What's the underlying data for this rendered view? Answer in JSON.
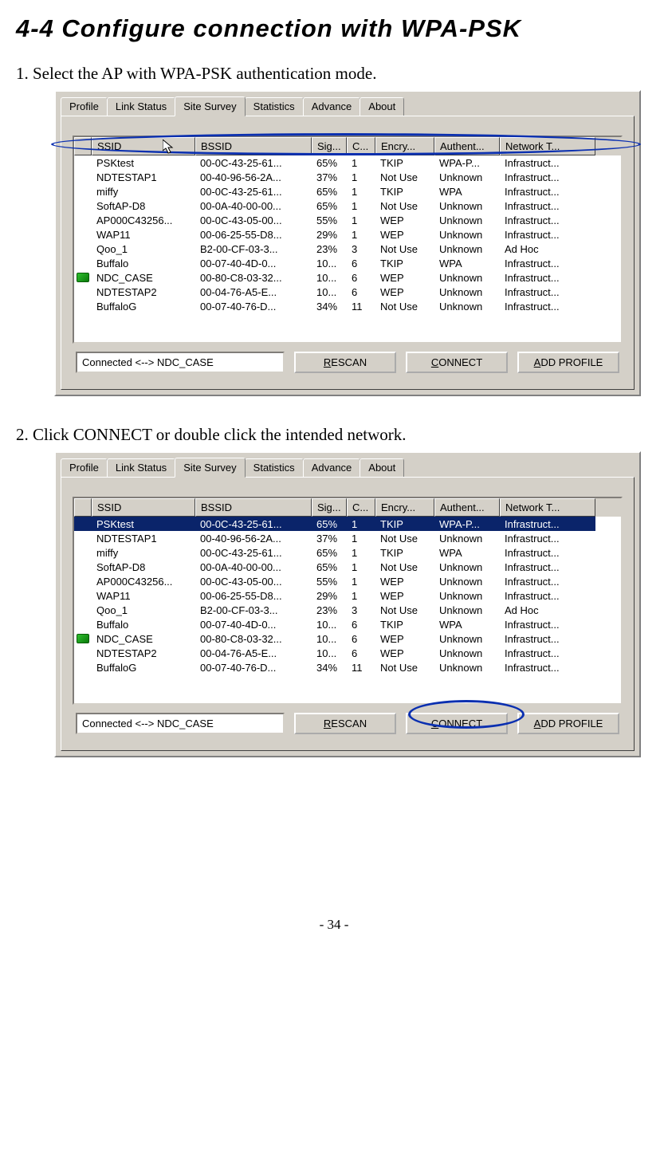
{
  "heading": "4-4   Configure connection with WPA-PSK",
  "step1": "1. Select the AP with WPA-PSK authentication mode.",
  "step2": "2. Click CONNECT or double click the intended network.",
  "footer": "- 34 -",
  "tabs": [
    "Profile",
    "Link Status",
    "Site Survey",
    "Statistics",
    "Advance",
    "About"
  ],
  "active_tab_index": 2,
  "columns": {
    "ssid": "SSID",
    "bssid": "BSSID",
    "sig": "Sig...",
    "ch": "C...",
    "enc": "Encry...",
    "auth": "Authent...",
    "net": "Network T..."
  },
  "rows": [
    {
      "icon": "",
      "ssid": "PSKtest",
      "bssid": "00-0C-43-25-61...",
      "sig": "65%",
      "ch": "1",
      "enc": "TKIP",
      "auth": "WPA-P...",
      "net": "Infrastruct..."
    },
    {
      "icon": "",
      "ssid": "NDTESTAP1",
      "bssid": "00-40-96-56-2A...",
      "sig": "37%",
      "ch": "1",
      "enc": "Not Use",
      "auth": "Unknown",
      "net": "Infrastruct..."
    },
    {
      "icon": "",
      "ssid": "miffy",
      "bssid": "00-0C-43-25-61...",
      "sig": "65%",
      "ch": "1",
      "enc": "TKIP",
      "auth": "WPA",
      "net": "Infrastruct..."
    },
    {
      "icon": "",
      "ssid": "SoftAP-D8",
      "bssid": "00-0A-40-00-00...",
      "sig": "65%",
      "ch": "1",
      "enc": "Not Use",
      "auth": "Unknown",
      "net": "Infrastruct..."
    },
    {
      "icon": "",
      "ssid": "AP000C43256...",
      "bssid": "00-0C-43-05-00...",
      "sig": "55%",
      "ch": "1",
      "enc": "WEP",
      "auth": "Unknown",
      "net": "Infrastruct..."
    },
    {
      "icon": "",
      "ssid": "WAP11",
      "bssid": "00-06-25-55-D8...",
      "sig": "29%",
      "ch": "1",
      "enc": "WEP",
      "auth": "Unknown",
      "net": "Infrastruct..."
    },
    {
      "icon": "",
      "ssid": "Qoo_1",
      "bssid": "B2-00-CF-03-3...",
      "sig": "23%",
      "ch": "3",
      "enc": "Not Use",
      "auth": "Unknown",
      "net": "Ad Hoc"
    },
    {
      "icon": "",
      "ssid": "Buffalo",
      "bssid": "00-07-40-4D-0...",
      "sig": "10...",
      "ch": "6",
      "enc": "TKIP",
      "auth": "WPA",
      "net": "Infrastruct..."
    },
    {
      "icon": "net",
      "ssid": "NDC_CASE",
      "bssid": "00-80-C8-03-32...",
      "sig": "10...",
      "ch": "6",
      "enc": "WEP",
      "auth": "Unknown",
      "net": "Infrastruct..."
    },
    {
      "icon": "",
      "ssid": "NDTESTAP2",
      "bssid": "00-04-76-A5-E...",
      "sig": "10...",
      "ch": "6",
      "enc": "WEP",
      "auth": "Unknown",
      "net": "Infrastruct..."
    },
    {
      "icon": "",
      "ssid": "BuffaloG",
      "bssid": "00-07-40-76-D...",
      "sig": "34%",
      "ch": "11",
      "enc": "Not Use",
      "auth": "Unknown",
      "net": "Infrastruct..."
    }
  ],
  "status_text": "Connected <--> NDC_CASE",
  "buttons": {
    "rescan": {
      "u": "R",
      "rest": "ESCAN"
    },
    "connect": {
      "u": "C",
      "rest": "ONNECT"
    },
    "add": {
      "u": "A",
      "rest": "DD PROFILE"
    }
  }
}
